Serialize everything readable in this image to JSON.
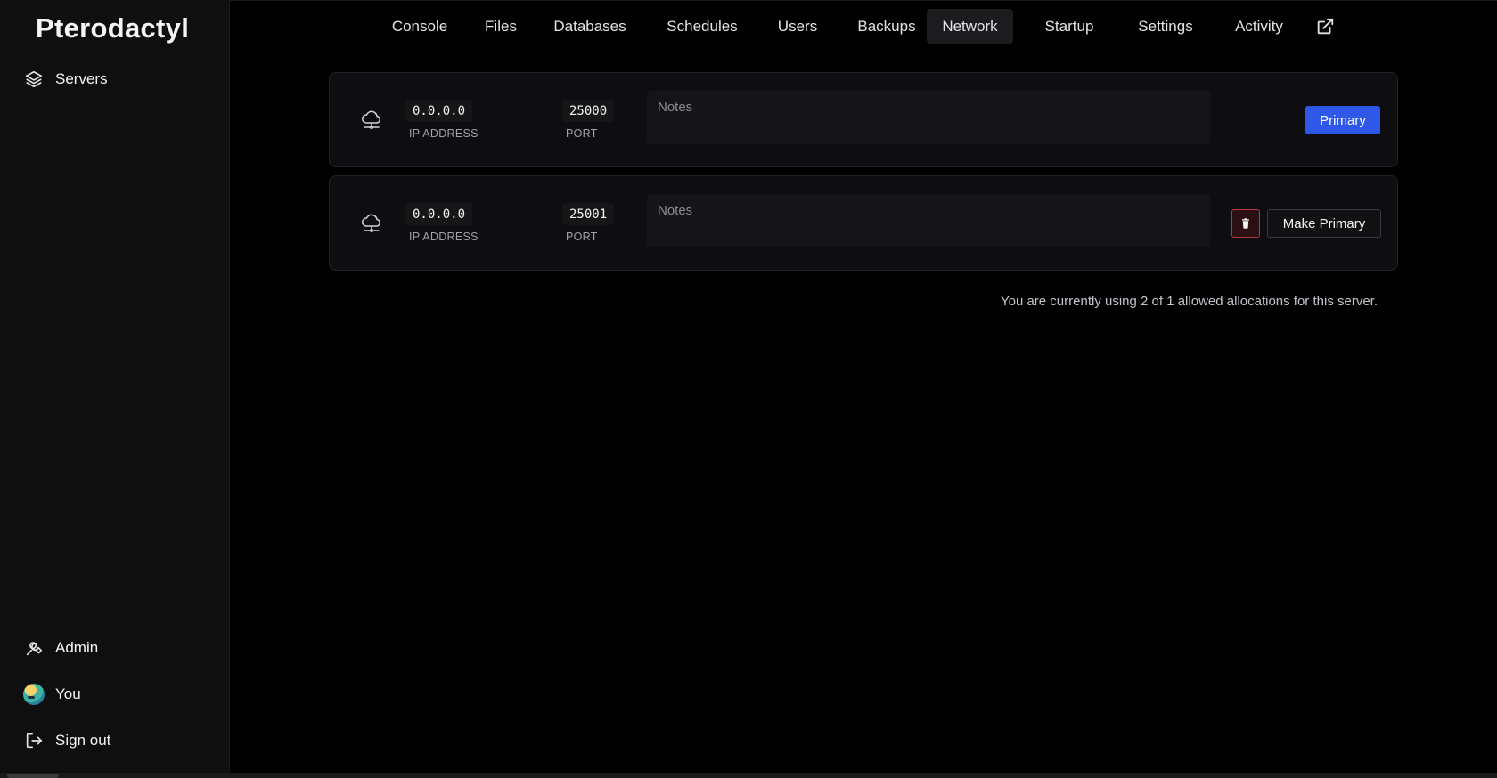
{
  "brand": "Pterodactyl",
  "sidebar": {
    "top_items": [
      {
        "label": "Servers",
        "icon": "layers-icon"
      }
    ],
    "bottom_items": [
      {
        "label": "Admin",
        "icon": "wrench-icon"
      },
      {
        "label": "You",
        "icon": "avatar"
      },
      {
        "label": "Sign out",
        "icon": "sign-out-icon"
      }
    ]
  },
  "nav": {
    "tabs": [
      {
        "label": "Console"
      },
      {
        "label": "Files"
      },
      {
        "label": "Databases"
      },
      {
        "label": "Schedules"
      },
      {
        "label": "Users"
      },
      {
        "label": "Backups"
      },
      {
        "label": "Network",
        "active": true
      },
      {
        "label": "Startup"
      },
      {
        "label": "Settings"
      },
      {
        "label": "Activity"
      }
    ],
    "external_icon": "external-link-icon"
  },
  "allocations": [
    {
      "ip": "0.0.0.0",
      "ip_label": "IP ADDRESS",
      "port": "25000",
      "port_label": "PORT",
      "notes_placeholder": "Notes",
      "primary_label": "Primary"
    },
    {
      "ip": "0.0.0.0",
      "ip_label": "IP ADDRESS",
      "port": "25001",
      "port_label": "PORT",
      "notes_placeholder": "Notes",
      "make_primary_label": "Make Primary"
    }
  ],
  "usage_text": "You are currently using 2 of 1 allowed allocations for this server.",
  "colors": {
    "accent": "#2f57e8",
    "danger": "#b03a3f",
    "background": "#000000",
    "sidebar": "#0f0f10"
  }
}
